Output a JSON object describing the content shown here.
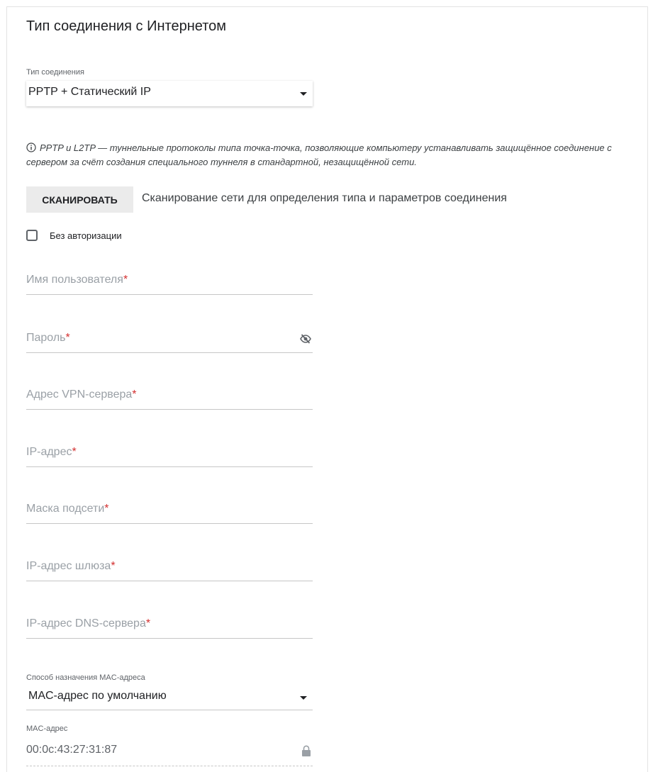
{
  "title": "Тип соединения с Интернетом",
  "connection_type": {
    "label": "Тип соединения",
    "value": "PPTP + Статический IP"
  },
  "info_text": "PPTP и L2TP — туннельные протоколы типа точка-точка, позволяющие компьютеру устанавливать защищённое соединение с сервером за счёт создания специального туннеля в стандартной, незащищённой сети.",
  "scan": {
    "button_label": "СКАНИРОВАТЬ",
    "description": "Сканирование сети для определения типа и параметров соединения"
  },
  "no_auth": {
    "label": "Без авторизации",
    "checked": false
  },
  "fields": {
    "username": "Имя пользователя",
    "password": "Пароль",
    "vpn_server": "Адрес VPN-сервера",
    "ip_address": "IP-адрес",
    "subnet_mask": "Маска подсети",
    "gateway": "IP-адрес шлюза",
    "dns_server": "IP-адрес DNS-сервера",
    "required_mark": "*"
  },
  "mac_method": {
    "label": "Способ назначения MAC-адреса",
    "value": "MAC-адрес по умолчанию"
  },
  "mac_address": {
    "label": "MAC-адрес",
    "value": "00:0c:43:27:31:87"
  },
  "icons": {
    "info": "info-icon",
    "dropdown": "caret-down-icon",
    "password_visibility": "eye-slash-icon",
    "locked": "lock-icon"
  },
  "colors": {
    "required": "#d32f2f",
    "button_bg": "#ebebeb",
    "placeholder": "#9aa0a6"
  }
}
